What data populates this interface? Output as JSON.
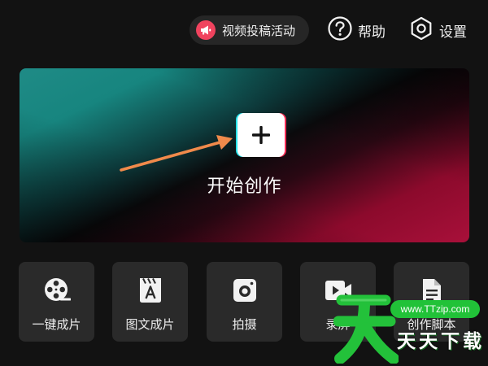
{
  "topbar": {
    "campaign_label": "视频投稿活动",
    "help_label": "帮助",
    "settings_label": "设置"
  },
  "hero": {
    "caption": "开始创作"
  },
  "tools": [
    {
      "label": "一键成片",
      "icon": "film-reel-icon"
    },
    {
      "label": "图文成片",
      "icon": "text-clapboard-icon"
    },
    {
      "label": "拍摄",
      "icon": "camera-icon"
    },
    {
      "label": "录屏",
      "icon": "video-camera-icon"
    },
    {
      "label": "创作脚本",
      "icon": "document-icon"
    }
  ],
  "watermark": {
    "url": "www.TTzip.com",
    "text": "天天下载"
  },
  "colors": {
    "background": "#121212",
    "card": "#2a2a2a",
    "accent_red": "#f0435e",
    "accent_cyan": "#27e3ea",
    "arrow": "#f08a4b",
    "watermark_green": "#21c238"
  }
}
